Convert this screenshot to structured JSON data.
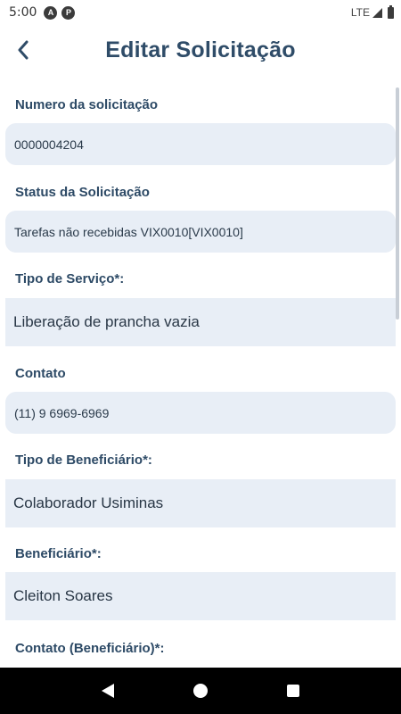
{
  "status_bar": {
    "time": "5:00",
    "app_icons": [
      "A",
      "P"
    ],
    "network": "LTE"
  },
  "header": {
    "title": "Editar Solicitação"
  },
  "fields": [
    {
      "label": "Numero da solicitação",
      "value": "0000004204"
    },
    {
      "label": "Status da Solicitação",
      "value": "Tarefas não recebidas VIX0010[VIX0010]"
    },
    {
      "label": "Tipo de Serviço*:",
      "value": "Liberação de prancha vazia"
    },
    {
      "label": "Contato",
      "value": "(11) 9 6969-6969"
    },
    {
      "label": "Tipo de Beneficiário*:",
      "value": "Colaborador Usiminas"
    },
    {
      "label": "Beneficiário*:",
      "value": "Cleiton Soares"
    },
    {
      "label": "Contato (Beneficiário)*:",
      "value": ""
    }
  ]
}
